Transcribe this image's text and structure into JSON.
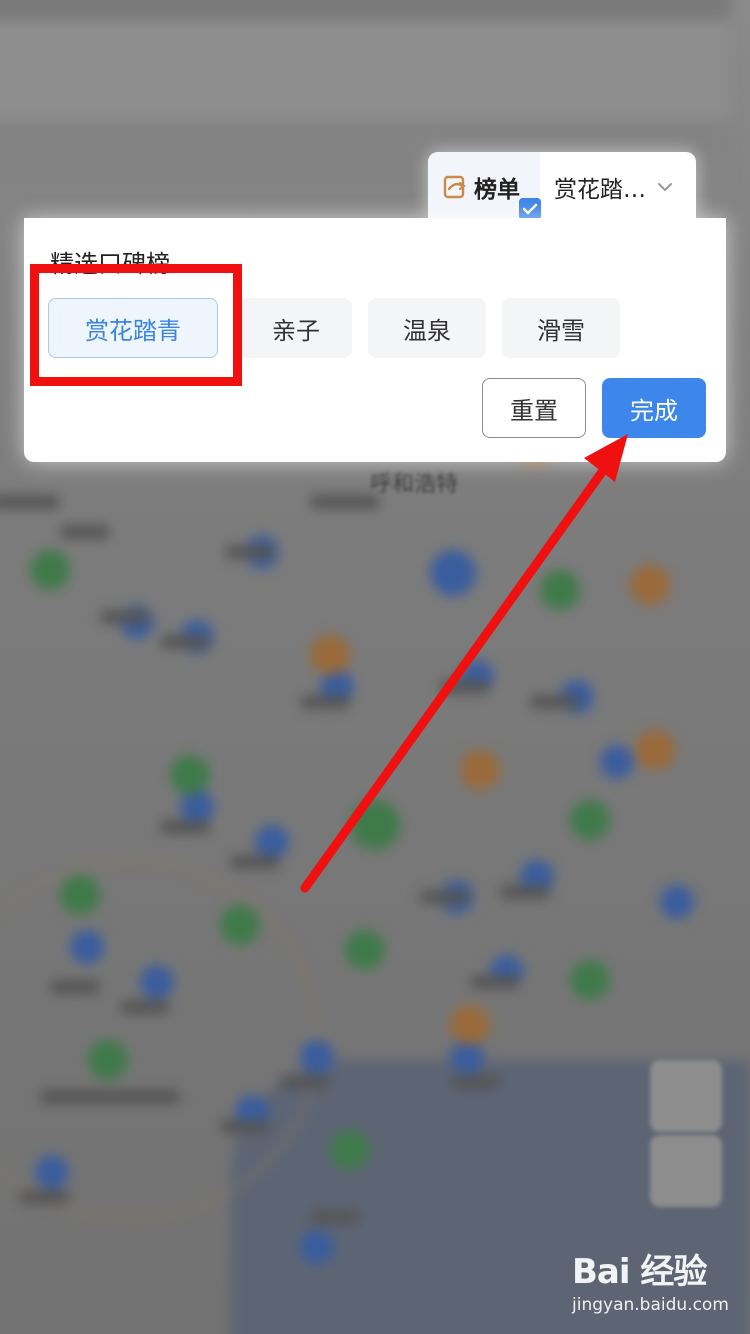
{
  "rank_tab": {
    "label": "榜单",
    "selected_value": "赏花踏…"
  },
  "panel": {
    "section_title": "精选口碑榜",
    "options": [
      {
        "label": "赏花踏青",
        "selected": true
      },
      {
        "label": "亲子",
        "selected": false
      },
      {
        "label": "温泉",
        "selected": false
      },
      {
        "label": "滑雪",
        "selected": false
      }
    ],
    "reset_label": "重置",
    "done_label": "完成"
  },
  "map": {
    "city_label": "呼和浩特"
  },
  "watermark": {
    "logo": "Bai 经验",
    "url": "jingyan.baidu.com"
  },
  "colors": {
    "accent": "#3c86ec",
    "annotation": "#f01010"
  }
}
